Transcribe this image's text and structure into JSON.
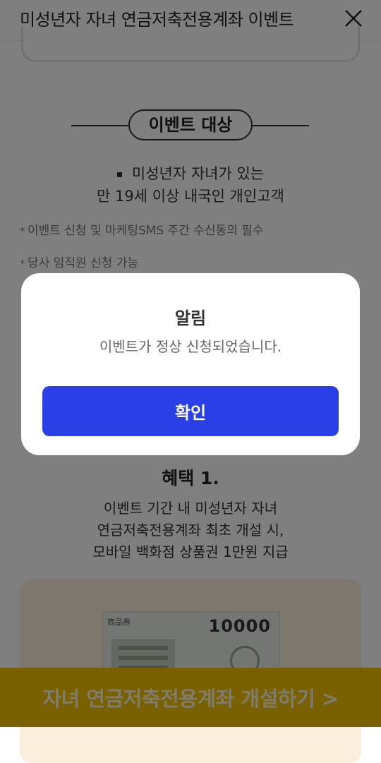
{
  "header": {
    "title": "미성년자 자녀 연금저축전용계좌 이벤트"
  },
  "target_section": {
    "title": "이벤트 대상",
    "line1": "미성년자 자녀가 있는",
    "line2": "만 19세 이상 내국인 개인고객",
    "note1": "이벤트 신청 및 마케팅SMS 주간 수신동의 필수",
    "note2": "당사 임직원 신청 가능",
    "note_marker": "*"
  },
  "benefit": {
    "title": "혜택 1.",
    "line1": "이벤트 기간 내 미성년자 자녀",
    "line2": "연금저축전용계좌 최초 개설 시,",
    "line3": "모바일 백화점 상품권 1만원 지급"
  },
  "voucher": {
    "head": "商品券",
    "amount": "10000"
  },
  "cta": {
    "label": "자녀 연금저축전용계좌 개설하기 >"
  },
  "modal": {
    "title": "알림",
    "message": "이벤트가 정상 신청되었습니다.",
    "confirm_label": "확인"
  },
  "colors": {
    "primary_button": "#2a40e6",
    "cta_bar": "#f2c200",
    "overlay": "rgba(0,0,0,0.5)"
  }
}
